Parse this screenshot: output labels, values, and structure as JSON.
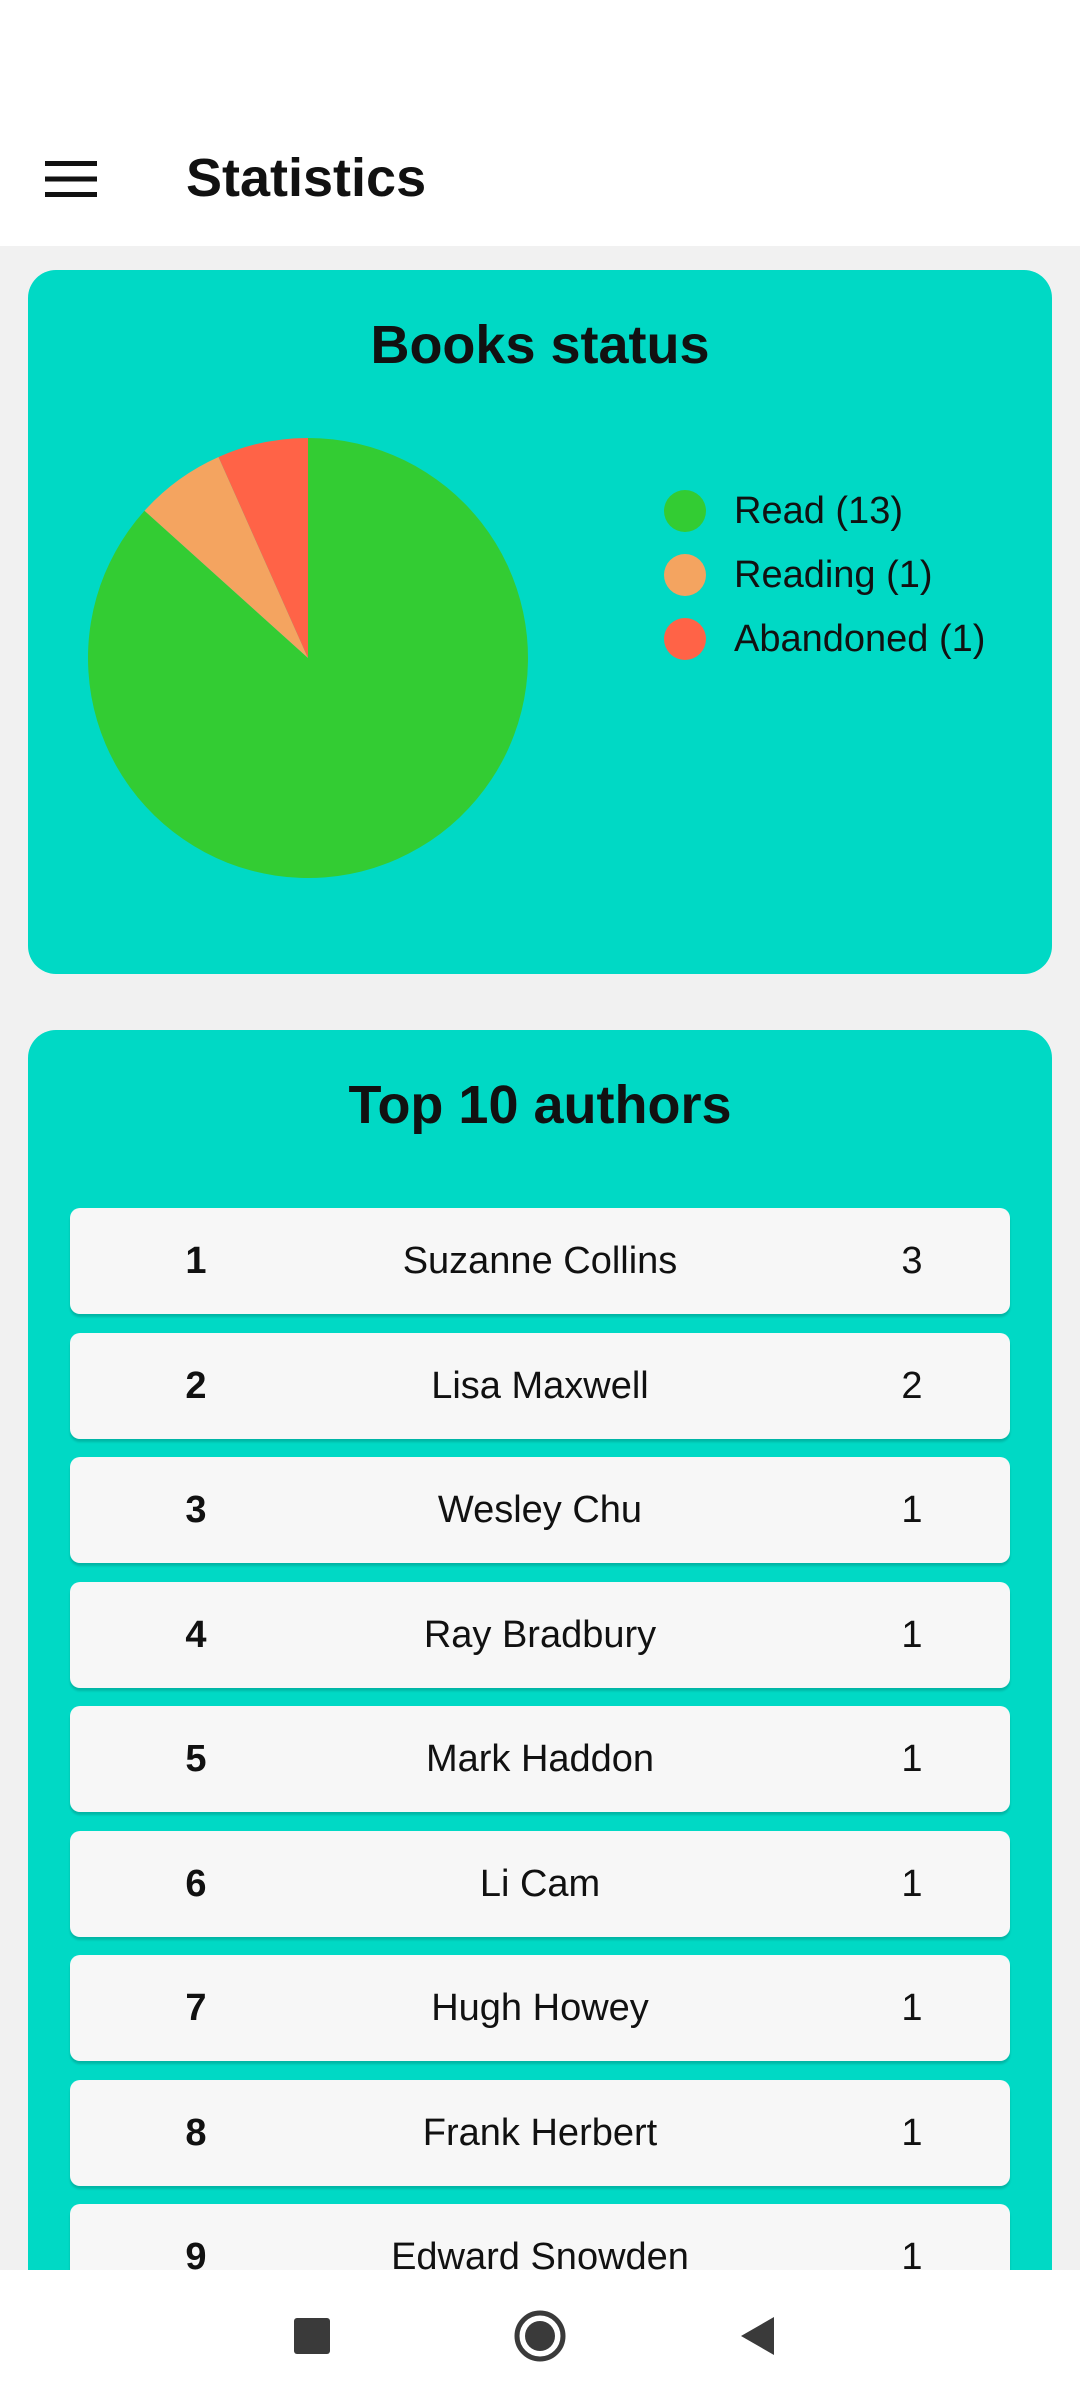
{
  "app_bar": {
    "title": "Statistics",
    "menu_icon": "hamburger-menu-icon"
  },
  "books_status": {
    "title": "Books status",
    "legend": [
      {
        "label": "Read (13)",
        "color": "#33cc33"
      },
      {
        "label": "Reading (1)",
        "color": "#f4a460"
      },
      {
        "label": "Abandoned (1)",
        "color": "#ff6347"
      }
    ]
  },
  "chart_data": {
    "type": "pie",
    "title": "Books status",
    "categories": [
      "Read",
      "Reading",
      "Abandoned"
    ],
    "values": [
      13,
      1,
      1
    ],
    "colors": [
      "#33cc33",
      "#f4a460",
      "#ff6347"
    ],
    "legend": "right"
  },
  "top_authors": {
    "title": "Top 10 authors",
    "rows": [
      {
        "rank": "1",
        "name": "Suzanne Collins",
        "count": "3"
      },
      {
        "rank": "2",
        "name": "Lisa Maxwell",
        "count": "2"
      },
      {
        "rank": "3",
        "name": "Wesley Chu",
        "count": "1"
      },
      {
        "rank": "4",
        "name": "Ray Bradbury",
        "count": "1"
      },
      {
        "rank": "5",
        "name": "Mark Haddon",
        "count": "1"
      },
      {
        "rank": "6",
        "name": "Li Cam",
        "count": "1"
      },
      {
        "rank": "7",
        "name": "Hugh Howey",
        "count": "1"
      },
      {
        "rank": "8",
        "name": "Frank Herbert",
        "count": "1"
      },
      {
        "rank": "9",
        "name": "Edward Snowden",
        "count": "1"
      }
    ]
  },
  "nav_bar": {
    "icons": [
      "recents-square-icon",
      "home-circle-icon",
      "back-triangle-icon"
    ]
  }
}
